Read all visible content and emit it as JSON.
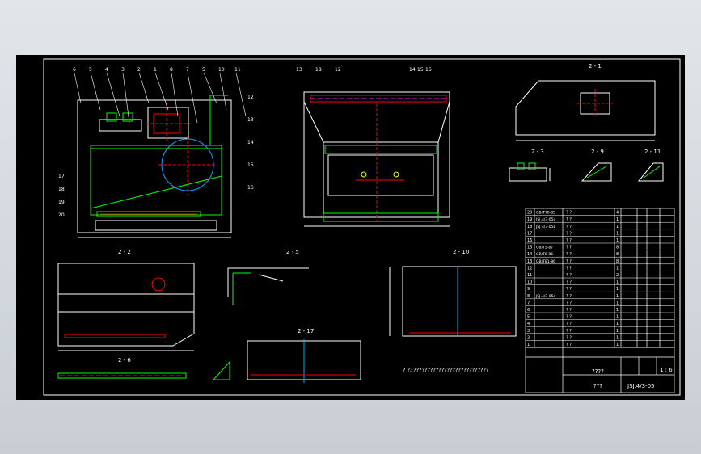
{
  "views": {
    "a1": "2 - 1",
    "a2": "2 - 2",
    "a3": "2 - 3",
    "a5": "2 - 5",
    "a6": "2 - 6",
    "a9": "2 - 9",
    "a10": "2 - 10",
    "a11": "2 - 11",
    "a17": "2 - 17"
  },
  "callouts_front": [
    "6",
    "5",
    "4",
    "3",
    "2",
    "1",
    "8",
    "7",
    "5",
    "10",
    "11",
    "12",
    "13",
    "14",
    "15",
    "16",
    "17",
    "18",
    "19",
    "20"
  ],
  "callouts_side": [
    "13",
    "18",
    "12",
    "14",
    "15",
    "16"
  ],
  "bom": {
    "rows": [
      {
        "no": "20",
        "code": "GB/T70-85",
        "name": "? ?",
        "qty": "4"
      },
      {
        "no": "19",
        "code": "JSJ.4/3-05c",
        "name": "? ?",
        "qty": "1"
      },
      {
        "no": "18",
        "code": "JSJ.4/3-05b",
        "name": "? ?",
        "qty": "1"
      },
      {
        "no": "17",
        "code": "",
        "name": "? ?",
        "qty": "1"
      },
      {
        "no": "16",
        "code": "",
        "name": "? ?",
        "qty": "1"
      },
      {
        "no": "15",
        "code": "GB/T5-87",
        "name": "? ?",
        "qty": "8"
      },
      {
        "no": "14",
        "code": "GB/T6-86",
        "name": "? ?",
        "qty": "8"
      },
      {
        "no": "13",
        "code": "GB/T81-86",
        "name": "? ?",
        "qty": "8"
      },
      {
        "no": "12",
        "code": "",
        "name": "? ?",
        "qty": "1"
      },
      {
        "no": "11",
        "code": "",
        "name": "? ?",
        "qty": "2"
      },
      {
        "no": "10",
        "code": "",
        "name": "? ?",
        "qty": "1"
      },
      {
        "no": "9",
        "code": "",
        "name": "? ?",
        "qty": "1"
      },
      {
        "no": "8",
        "code": "JSJ.4/3-05a",
        "name": "? ?",
        "qty": "1"
      },
      {
        "no": "7",
        "code": "",
        "name": "? ?",
        "qty": "1"
      },
      {
        "no": "6",
        "code": "",
        "name": "? ?",
        "qty": "1"
      },
      {
        "no": "5",
        "code": "",
        "name": "? ?",
        "qty": "1"
      },
      {
        "no": "4",
        "code": "",
        "name": "? ?",
        "qty": "1"
      },
      {
        "no": "3",
        "code": "",
        "name": "? ?",
        "qty": "1"
      },
      {
        "no": "2",
        "code": "",
        "name": "? ?",
        "qty": "1"
      },
      {
        "no": "1",
        "code": "",
        "name": "? ?",
        "qty": "1"
      }
    ]
  },
  "title_block": {
    "name": "????",
    "scale": "1 : 6",
    "company": "???",
    "drawing_no": "JSJ.4/3-05"
  },
  "notes": "?  ?: ???????????????????????????"
}
